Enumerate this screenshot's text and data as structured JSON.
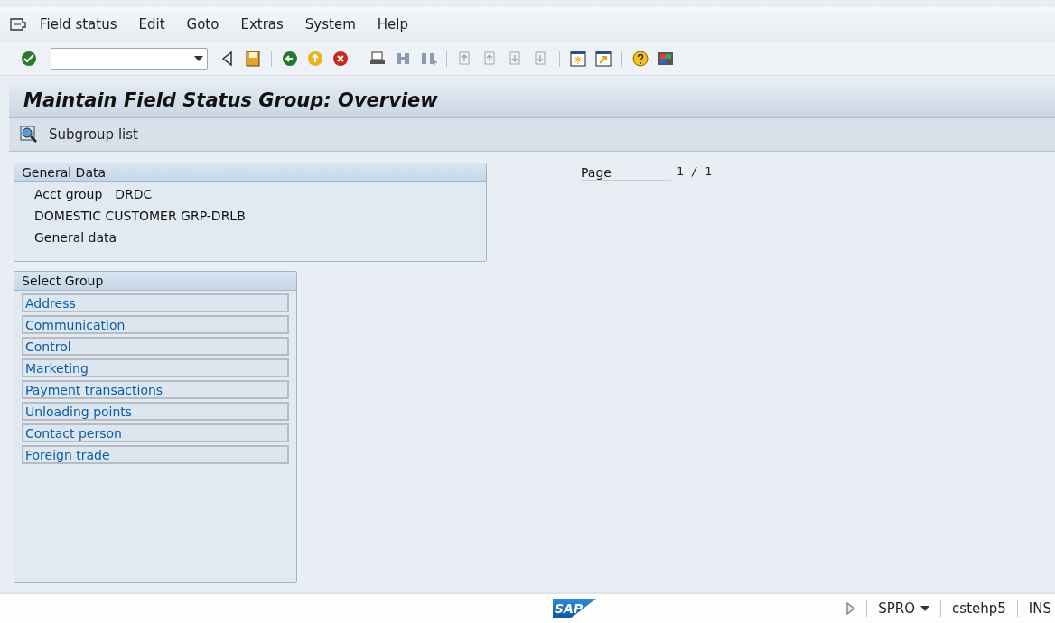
{
  "menu": [
    "Field status",
    "Edit",
    "Goto",
    "Extras",
    "System",
    "Help"
  ],
  "title": "Maintain Field Status Group: Overview",
  "app_toolbar": [
    {
      "label": "Subgroup list"
    }
  ],
  "general_data": {
    "header": "General Data",
    "label": "Acct group",
    "value": "DRDC",
    "description": "DOMESTIC CUSTOMER GRP-DRLB",
    "subtitle": "General data"
  },
  "page_indicator": {
    "label": "Page",
    "value": "1 / 1"
  },
  "select_group": {
    "header": "Select Group",
    "items": [
      "Address",
      "Communication",
      "Control",
      "Marketing",
      "Payment transactions",
      "Unloading points",
      "Contact person",
      "Foreign trade"
    ]
  },
  "status_bar": {
    "logo": "SAP",
    "transaction": "SPRO",
    "server": "cstehp5",
    "mode": "INS"
  }
}
